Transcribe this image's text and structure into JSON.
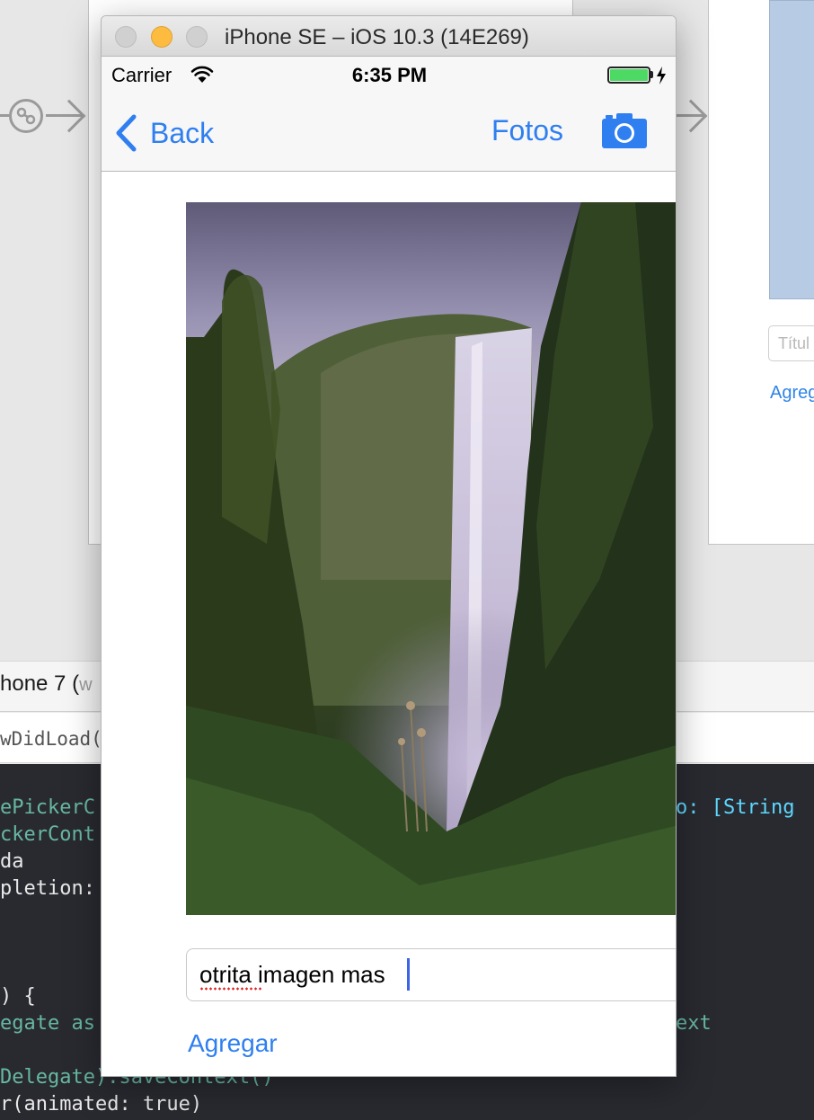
{
  "background": {
    "right_scene": {
      "field_placeholder": "Títul",
      "link_label": "Agreg"
    },
    "device_bar": {
      "device_name": "hone 7 (",
      "device_detail": "w"
    },
    "jump_bar": {
      "method": "wDidLoad()"
    },
    "code_lines": [
      {
        "text": "ePickerC",
        "class": "c-teal"
      },
      {
        "text": "ckerCont",
        "class": "c-teal"
      },
      {
        "text": "da",
        "class": ""
      },
      {
        "text": "pletion:",
        "class": ""
      },
      {
        "text": ") {",
        "class": ""
      },
      {
        "text": "egate as",
        "class": "c-teal"
      },
      {
        "text": "Delegate).saveContext()",
        "class": "c-teal"
      },
      {
        "text": "r(animated: true)",
        "class": ""
      }
    ],
    "code_right": [
      "o: [String",
      "ext"
    ]
  },
  "simulator": {
    "window_title": "iPhone SE – iOS 10.3 (14E269)",
    "status_bar": {
      "carrier": "Carrier",
      "time": "6:35 PM",
      "battery_level": 1.0,
      "charging": true
    },
    "nav_bar": {
      "back_label": "Back",
      "fotos_label": "Fotos",
      "camera_icon": "camera-icon"
    },
    "photo": {
      "subject": "waterfall-photo"
    },
    "title_field": {
      "value": "otrita imagen mas",
      "misspelled": "otrita"
    },
    "add_button_label": "Agregar"
  },
  "colors": {
    "ios_tint": "#2f7ff0",
    "code_background": "#292a30",
    "battery": "#4cd964"
  }
}
